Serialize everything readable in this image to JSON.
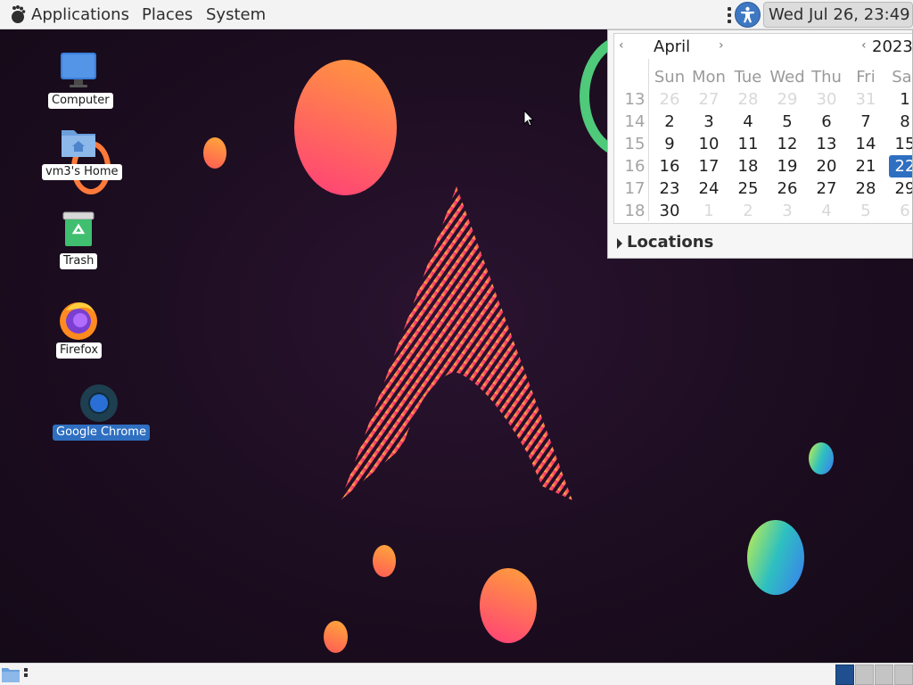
{
  "top_panel": {
    "menus": [
      "Applications",
      "Places",
      "System"
    ],
    "clock": "Wed Jul 26, 23:49",
    "icons": {
      "logo": "gnome-foot-icon",
      "accessibility": "accessibility-icon"
    }
  },
  "desktop_icons": [
    {
      "label": "Computer",
      "icon": "computer-icon"
    },
    {
      "label": "vm3's Home",
      "icon": "home-folder-icon"
    },
    {
      "label": "Trash",
      "icon": "trash-icon"
    },
    {
      "label": "Firefox",
      "icon": "firefox-icon"
    },
    {
      "label": "Google Chrome",
      "icon": "chrome-icon",
      "selected": true
    }
  ],
  "calendar": {
    "month": "April",
    "year": "2023",
    "prev_symbol": "‹",
    "next_symbol": "›",
    "weekday_headers": [
      "Sun",
      "Mon",
      "Tue",
      "Wed",
      "Thu",
      "Fri",
      "Sat"
    ],
    "weeks": [
      {
        "number": "13",
        "days": [
          "26",
          "27",
          "28",
          "29",
          "30",
          "31",
          "1"
        ]
      },
      {
        "number": "14",
        "days": [
          "2",
          "3",
          "4",
          "5",
          "6",
          "7",
          "8"
        ]
      },
      {
        "number": "15",
        "days": [
          "9",
          "10",
          "11",
          "12",
          "13",
          "14",
          "15"
        ]
      },
      {
        "number": "16",
        "days": [
          "16",
          "17",
          "18",
          "19",
          "20",
          "21",
          "22"
        ]
      },
      {
        "number": "17",
        "days": [
          "23",
          "24",
          "25",
          "26",
          "27",
          "28",
          "29"
        ]
      },
      {
        "number": "18",
        "days": [
          "30",
          "1",
          "2",
          "3",
          "4",
          "5",
          "6"
        ]
      }
    ],
    "selected_day": "22",
    "locations_label": "Locations"
  },
  "colors": {
    "panel_bg": "#f3f3f3",
    "selection_blue": "#2f6fc1",
    "desktop_bg": "#1c0d20"
  }
}
